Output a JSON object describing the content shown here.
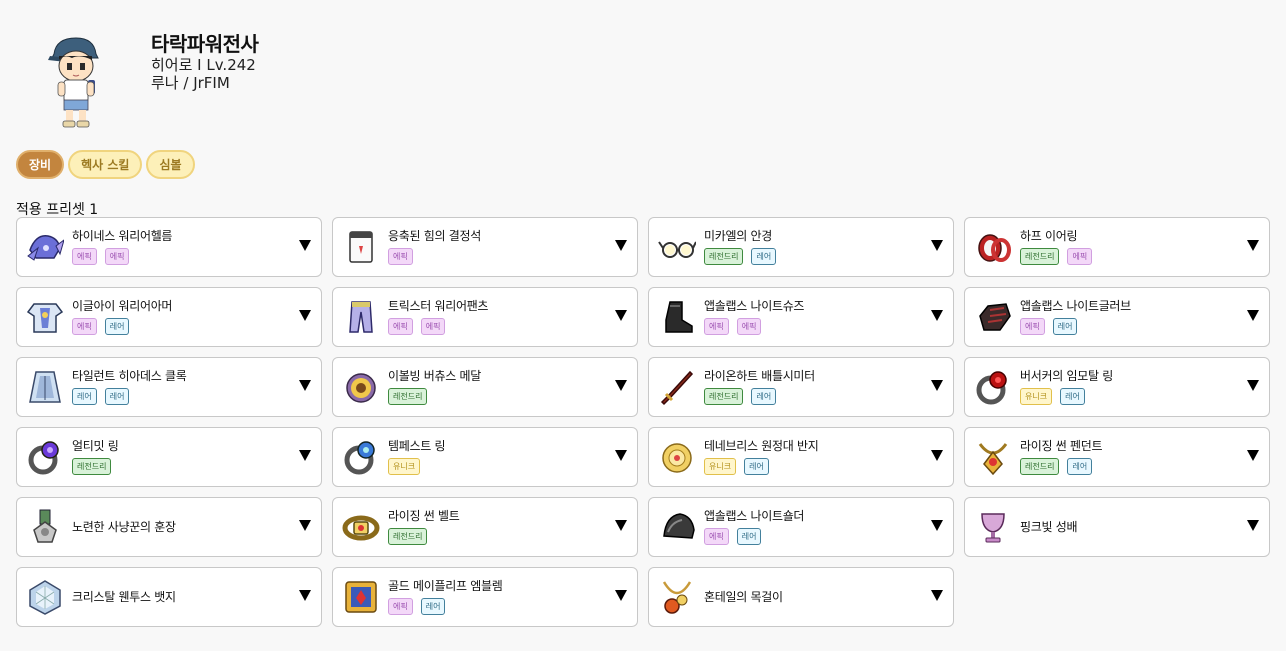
{
  "character": {
    "name": "타락파워전사",
    "job_level": "히어로 I Lv.242",
    "world_guild": "루나 / JrFIM"
  },
  "tabs": [
    {
      "label": "장비",
      "active": true
    },
    {
      "label": "헥사 스킬",
      "active": false
    },
    {
      "label": "심볼",
      "active": false
    }
  ],
  "preset_label": "적용 프리셋 1",
  "badge_colors": {
    "epic": "#f3d8f8",
    "rare": "#e8f8ff",
    "legendary": "#d9f2d9",
    "unique": "#fff6cc",
    "active_tab": "#c3853e",
    "inactive_tab": "#fdf0b9"
  },
  "items": [
    {
      "name": "하이네스 워리어헬름",
      "icon": "helmet-icon",
      "badges": [
        {
          "type": "epic",
          "label": "에픽"
        },
        {
          "type": "epic",
          "label": "에픽"
        }
      ]
    },
    {
      "name": "응축된 힘의 결정석",
      "icon": "crystal-card-icon",
      "badges": [
        {
          "type": "epic",
          "label": "에픽"
        }
      ]
    },
    {
      "name": "미카엘의 안경",
      "icon": "glasses-icon",
      "badges": [
        {
          "type": "legendary",
          "label": "레전드리"
        },
        {
          "type": "rare",
          "label": "레어"
        }
      ]
    },
    {
      "name": "하프 이어링",
      "icon": "earring-icon",
      "badges": [
        {
          "type": "legendary",
          "label": "레전드리"
        },
        {
          "type": "epic",
          "label": "에픽"
        }
      ]
    },
    {
      "name": "이글아이 워리어아머",
      "icon": "armor-icon",
      "badges": [
        {
          "type": "epic",
          "label": "에픽"
        },
        {
          "type": "rare",
          "label": "레어"
        }
      ]
    },
    {
      "name": "트릭스터 워리어팬츠",
      "icon": "pants-icon",
      "badges": [
        {
          "type": "epic",
          "label": "에픽"
        },
        {
          "type": "epic",
          "label": "에픽"
        }
      ]
    },
    {
      "name": "앱솔랩스 나이트슈즈",
      "icon": "shoes-icon",
      "badges": [
        {
          "type": "epic",
          "label": "에픽"
        },
        {
          "type": "epic",
          "label": "에픽"
        }
      ]
    },
    {
      "name": "앱솔랩스 나이트글러브",
      "icon": "glove-icon",
      "badges": [
        {
          "type": "epic",
          "label": "에픽"
        },
        {
          "type": "rare",
          "label": "레어"
        }
      ]
    },
    {
      "name": "타일런트 히아데스 클록",
      "icon": "cloak-icon",
      "badges": [
        {
          "type": "rare",
          "label": "레어"
        },
        {
          "type": "rare",
          "label": "레어"
        }
      ]
    },
    {
      "name": "이볼빙 버츄스 메달",
      "icon": "medal-icon",
      "badges": [
        {
          "type": "legendary",
          "label": "레전드리"
        }
      ]
    },
    {
      "name": "라이온하트 배틀시미터",
      "icon": "sword-icon",
      "badges": [
        {
          "type": "legendary",
          "label": "레전드리"
        },
        {
          "type": "rare",
          "label": "레어"
        }
      ]
    },
    {
      "name": "버서커의 임모탈 링",
      "icon": "ring-red-icon",
      "badges": [
        {
          "type": "unique",
          "label": "유니크"
        },
        {
          "type": "rare",
          "label": "레어"
        }
      ]
    },
    {
      "name": "얼티밋 링",
      "icon": "ring-purple-icon",
      "badges": [
        {
          "type": "legendary",
          "label": "레전드리"
        }
      ]
    },
    {
      "name": "템페스트 링",
      "icon": "ring-blue-icon",
      "badges": [
        {
          "type": "unique",
          "label": "유니크"
        }
      ]
    },
    {
      "name": "테네브리스 원정대 반지",
      "icon": "ring-gold-icon",
      "badges": [
        {
          "type": "unique",
          "label": "유니크"
        },
        {
          "type": "rare",
          "label": "레어"
        }
      ]
    },
    {
      "name": "라이징 썬 펜던트",
      "icon": "pendant-icon",
      "badges": [
        {
          "type": "legendary",
          "label": "레전드리"
        },
        {
          "type": "rare",
          "label": "레어"
        }
      ]
    },
    {
      "name": "노련한 사냥꾼의 훈장",
      "icon": "badge-medal-icon",
      "badges": []
    },
    {
      "name": "라이징 썬 벨트",
      "icon": "belt-icon",
      "badges": [
        {
          "type": "legendary",
          "label": "레전드리"
        }
      ]
    },
    {
      "name": "앱솔랩스 나이트숄더",
      "icon": "shoulder-icon",
      "badges": [
        {
          "type": "epic",
          "label": "에픽"
        },
        {
          "type": "rare",
          "label": "레어"
        }
      ]
    },
    {
      "name": "핑크빛 성배",
      "icon": "chalice-icon",
      "badges": []
    },
    {
      "name": "크리스탈 웬투스 뱃지",
      "icon": "crystal-badge-icon",
      "badges": []
    },
    {
      "name": "골드 메이플리프 엠블렘",
      "icon": "emblem-icon",
      "badges": [
        {
          "type": "epic",
          "label": "에픽"
        },
        {
          "type": "rare",
          "label": "레어"
        }
      ]
    },
    {
      "name": "혼테일의 목걸이",
      "icon": "necklace-icon",
      "badges": []
    }
  ]
}
